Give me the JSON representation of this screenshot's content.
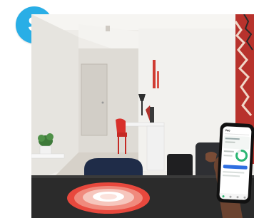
{
  "badge": {
    "symbol": "$",
    "color": "#29aee6"
  },
  "scene": {
    "wall_color": "#eceae6",
    "floor_color": "#d9d4cc",
    "table_color": "#2b2b2b",
    "doily_color": "#e8483d",
    "chair_red": "#d8302b",
    "chair_navy": "#1f2c48",
    "curtain_color": "#c9312b"
  },
  "phone": {
    "ring_value": 0.8,
    "accent": "#2bb673",
    "app_logo": "Veo"
  }
}
